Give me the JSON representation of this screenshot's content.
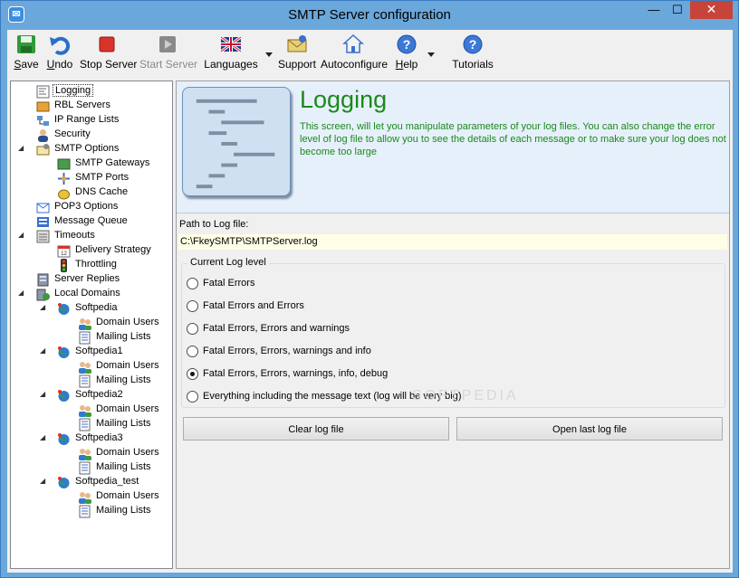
{
  "window": {
    "title": "SMTP Server configuration",
    "minimize": "—",
    "maximize": "☐",
    "close": "✕"
  },
  "toolbar": {
    "save_prefix": "S",
    "save_rest": "ave",
    "undo_prefix": "U",
    "undo_rest": "ndo",
    "stop_server": "Stop Server",
    "start_server": "Start Server",
    "languages": "Languages",
    "support": "Support",
    "autoconfigure": "Autoconfigure",
    "help_prefix": "H",
    "help_rest": "elp",
    "tutorials": "Tutorials"
  },
  "tree": {
    "logging": "Logging",
    "rbl_servers": "RBL Servers",
    "ip_range_lists": "IP Range Lists",
    "security": "Security",
    "smtp_options": "SMTP Options",
    "smtp_gateways": "SMTP Gateways",
    "smtp_ports": "SMTP Ports",
    "dns_cache": "DNS Cache",
    "pop3_options": "POP3 Options",
    "message_queue": "Message Queue",
    "timeouts": "Timeouts",
    "delivery_strategy": "Delivery Strategy",
    "throttling": "Throttling",
    "server_replies": "Server Replies",
    "local_domains": "Local Domains",
    "domains": [
      {
        "name": "Softpedia",
        "users": "Domain Users",
        "lists": "Mailing Lists"
      },
      {
        "name": "Softpedia1",
        "users": "Domain Users",
        "lists": "Mailing Lists"
      },
      {
        "name": "Softpedia2",
        "users": "Domain Users",
        "lists": "Mailing Lists"
      },
      {
        "name": "Softpedia3",
        "users": "Domain Users",
        "lists": "Mailing Lists"
      },
      {
        "name": "Softpedia_test",
        "users": "Domain Users",
        "lists": "Mailing Lists"
      }
    ]
  },
  "content": {
    "title": "Logging",
    "description": "This screen, will let you manipulate parameters of your log files. You can also change the error level of log file to allow you to see the details of each message or to make sure your log does not become too large",
    "path_label": "Path to Log file:",
    "path_value": "C:\\FkeySMTP\\SMTPServer.log",
    "log_level_label": "Current Log level",
    "levels": [
      "Fatal Errors",
      "Fatal Errors and Errors",
      "Fatal Errors, Errors and warnings",
      "Fatal Errors, Errors, warnings and  info",
      "Fatal Errors, Errors, warnings, info, debug",
      "Everything including the message text (log will be very big)"
    ],
    "selected_level": 4,
    "clear_button": "Clear log file",
    "open_button": "Open last log file",
    "watermark": "SOFTPEDIA"
  },
  "colors": {
    "accent_green": "#1a8a1a",
    "window_border": "#6aa7db",
    "close_red": "#c7443b"
  }
}
